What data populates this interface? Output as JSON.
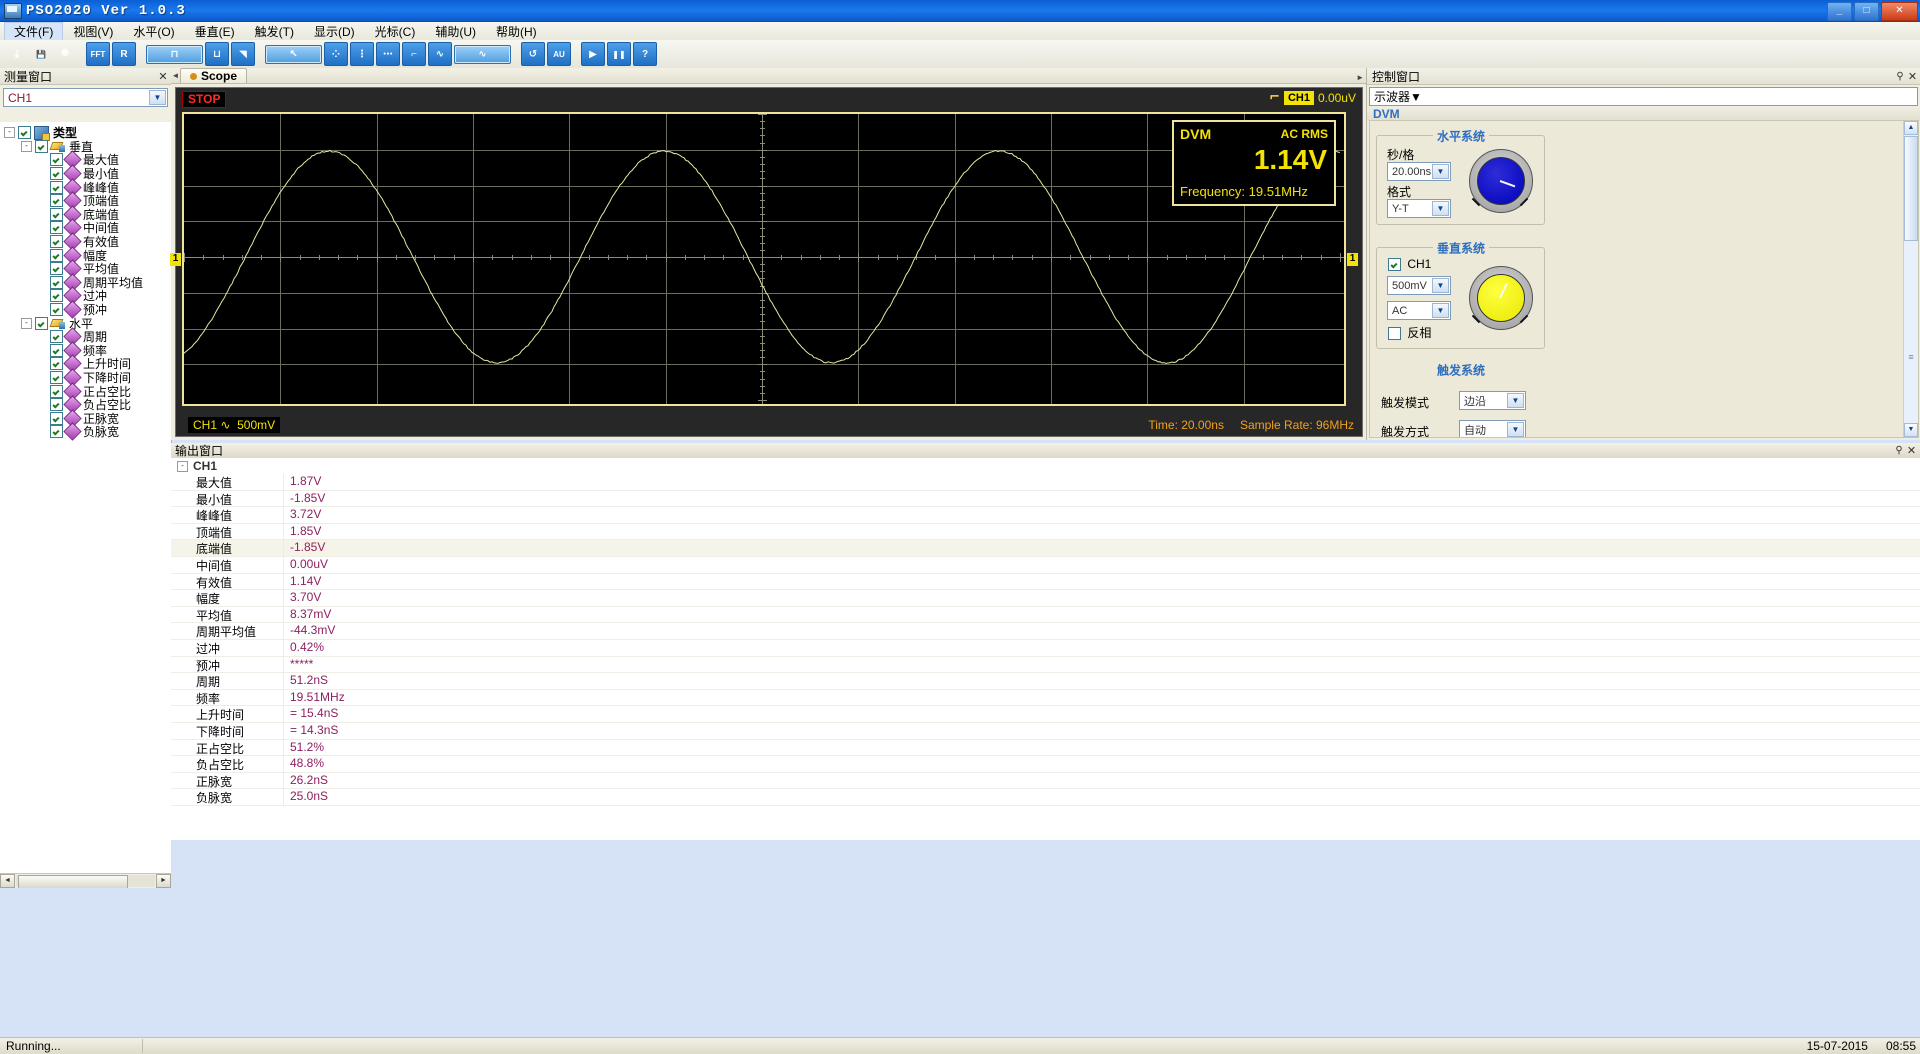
{
  "window": {
    "title": "PSO2020 Ver 1.0.3",
    "minimize": "_",
    "maximize": "□",
    "close": "✕"
  },
  "menu": [
    {
      "label": "文件(F)"
    },
    {
      "label": "视图(V)"
    },
    {
      "label": "水平(O)"
    },
    {
      "label": "垂直(E)"
    },
    {
      "label": "触发(T)"
    },
    {
      "label": "显示(D)"
    },
    {
      "label": "光标(C)"
    },
    {
      "label": "辅助(U)"
    },
    {
      "label": "帮助(H)"
    }
  ],
  "toolbar": [
    {
      "name": "open-icon",
      "glyph": "⤓",
      "style": "plain"
    },
    {
      "name": "save-icon",
      "glyph": "💾",
      "style": "plain"
    },
    {
      "name": "print-icon",
      "glyph": "🖶",
      "style": "plain"
    },
    {
      "name": "fft-icon",
      "glyph": "FFT",
      "style": "blue"
    },
    {
      "name": "record-icon",
      "glyph": "R",
      "style": "blue"
    },
    {
      "name": "square-wave-icon",
      "glyph": "⊓",
      "style": "sel"
    },
    {
      "name": "pulse-icon",
      "glyph": "⊔",
      "style": "blue"
    },
    {
      "name": "ramp-icon",
      "glyph": "◥",
      "style": "blue"
    },
    {
      "name": "cursor-icon",
      "glyph": "↖",
      "style": "sel"
    },
    {
      "name": "grid-icon",
      "glyph": "⁘",
      "style": "blue"
    },
    {
      "name": "vertical-cursor-icon",
      "glyph": "⋮",
      "style": "blue"
    },
    {
      "name": "horizontal-cursor-icon",
      "glyph": "⋯",
      "style": "blue"
    },
    {
      "name": "step-icon",
      "glyph": "⌐",
      "style": "blue"
    },
    {
      "name": "sine-icon",
      "glyph": "∿",
      "style": "blue"
    },
    {
      "name": "sine2-icon",
      "glyph": "∿",
      "style": "sel"
    },
    {
      "name": "undo-icon",
      "glyph": "↺",
      "style": "blue"
    },
    {
      "name": "auto-icon",
      "glyph": "AU",
      "style": "blue"
    },
    {
      "name": "run-icon",
      "glyph": "▶",
      "style": "blue"
    },
    {
      "name": "pause-icon",
      "glyph": "❚❚",
      "style": "blue"
    },
    {
      "name": "help-icon",
      "glyph": "?",
      "style": "blue"
    }
  ],
  "measure_dock": {
    "title": "测量窗口",
    "close": "✕",
    "channel_value": "CH1",
    "tree": [
      {
        "label": "类型",
        "level": 0,
        "icon": "category",
        "expander": "-",
        "checked": true,
        "bold": true
      },
      {
        "label": "垂直",
        "level": 1,
        "icon": "group",
        "expander": "-",
        "checked": true,
        "bold": false
      },
      {
        "label": "最大值",
        "level": 2,
        "icon": "leaf",
        "checked": true
      },
      {
        "label": "最小值",
        "level": 2,
        "icon": "leaf",
        "checked": true
      },
      {
        "label": "峰峰值",
        "level": 2,
        "icon": "leaf",
        "checked": true
      },
      {
        "label": "顶端值",
        "level": 2,
        "icon": "leaf",
        "checked": true
      },
      {
        "label": "底端值",
        "level": 2,
        "icon": "leaf",
        "checked": true
      },
      {
        "label": "中间值",
        "level": 2,
        "icon": "leaf",
        "checked": true
      },
      {
        "label": "有效值",
        "level": 2,
        "icon": "leaf",
        "checked": true
      },
      {
        "label": "幅度",
        "level": 2,
        "icon": "leaf",
        "checked": true
      },
      {
        "label": "平均值",
        "level": 2,
        "icon": "leaf",
        "checked": true
      },
      {
        "label": "周期平均值",
        "level": 2,
        "icon": "leaf",
        "checked": true
      },
      {
        "label": "过冲",
        "level": 2,
        "icon": "leaf",
        "checked": true
      },
      {
        "label": "预冲",
        "level": 2,
        "icon": "leaf",
        "checked": true
      },
      {
        "label": "水平",
        "level": 1,
        "icon": "group",
        "expander": "-",
        "checked": true,
        "bold": false
      },
      {
        "label": "周期",
        "level": 2,
        "icon": "leaf",
        "checked": true
      },
      {
        "label": "频率",
        "level": 2,
        "icon": "leaf",
        "checked": true
      },
      {
        "label": "上升时间",
        "level": 2,
        "icon": "leaf",
        "checked": true
      },
      {
        "label": "下降时间",
        "level": 2,
        "icon": "leaf",
        "checked": true
      },
      {
        "label": "正占空比",
        "level": 2,
        "icon": "leaf",
        "checked": true
      },
      {
        "label": "负占空比",
        "level": 2,
        "icon": "leaf",
        "checked": true
      },
      {
        "label": "正脉宽",
        "level": 2,
        "icon": "leaf",
        "checked": true
      },
      {
        "label": "负脉宽",
        "level": 2,
        "icon": "leaf",
        "checked": true
      }
    ]
  },
  "scope": {
    "tab_label": "Scope",
    "nav_left": "◄",
    "nav_right": "►",
    "run_state": "STOP",
    "trigger_channel": "CH1",
    "trigger_level": "0.00uV",
    "marker_left": "1",
    "marker_right": "1",
    "dvm": {
      "title": "DVM",
      "mode": "AC RMS",
      "value": "1.14V",
      "frequency": "Frequency: 19.51MHz"
    },
    "channel_badge": "CH1",
    "coupling_glyph": "∿",
    "volts_per_div": "500mV",
    "time_label": "Time: 20.00ns",
    "sample_rate_label": "Sample Rate: 96MHz"
  },
  "output_window": {
    "title": "输出窗口",
    "pin": "⚲",
    "close": "✕",
    "group_label": "CH1",
    "group_expander": "-",
    "rows": [
      {
        "label": "最大值",
        "value": "1.87V",
        "highlight": false
      },
      {
        "label": "最小值",
        "value": "-1.85V",
        "highlight": false
      },
      {
        "label": "峰峰值",
        "value": "3.72V",
        "highlight": false
      },
      {
        "label": "顶端值",
        "value": "1.85V",
        "highlight": false
      },
      {
        "label": "底端值",
        "value": "-1.85V",
        "highlight": true
      },
      {
        "label": "中间值",
        "value": "0.00uV",
        "highlight": false
      },
      {
        "label": "有效值",
        "value": "1.14V",
        "highlight": false
      },
      {
        "label": "幅度",
        "value": "3.70V",
        "highlight": false
      },
      {
        "label": "平均值",
        "value": "8.37mV",
        "highlight": false
      },
      {
        "label": "周期平均值",
        "value": "-44.3mV",
        "highlight": false
      },
      {
        "label": "过冲",
        "value": "0.42%",
        "highlight": false
      },
      {
        "label": "预冲",
        "value": "*****",
        "highlight": false
      },
      {
        "label": "周期",
        "value": "51.2nS",
        "highlight": false
      },
      {
        "label": "频率",
        "value": "19.51MHz",
        "highlight": false
      },
      {
        "label": "上升时间",
        "value": "= 15.4nS",
        "highlight": false
      },
      {
        "label": "下降时间",
        "value": "= 14.3nS",
        "highlight": false
      },
      {
        "label": "正占空比",
        "value": "51.2%",
        "highlight": false
      },
      {
        "label": "负占空比",
        "value": "48.8%",
        "highlight": false
      },
      {
        "label": "正脉宽",
        "value": "26.2nS",
        "highlight": false
      },
      {
        "label": "负脉宽",
        "value": "25.0nS",
        "highlight": false
      }
    ]
  },
  "control_dock": {
    "title": "控制窗口",
    "pin": "⚲",
    "close": "✕",
    "device_value": "示波器",
    "tab_label": "DVM",
    "horizontal": {
      "group_title": "水平系统",
      "sec_div_label": "秒/格",
      "sec_div_value": "20.00ns",
      "format_label": "格式",
      "format_value": "Y-T"
    },
    "vertical": {
      "group_title": "垂直系统",
      "channel_label": "CH1",
      "channel_checked": true,
      "volts_div_value": "500mV",
      "coupling_value": "AC",
      "invert_label": "反相",
      "invert_checked": false
    },
    "trigger": {
      "group_title": "触发系统",
      "mode_label": "触发模式",
      "mode_value": "边沿",
      "sweep_label": "触发方式",
      "sweep_value": "自动"
    }
  },
  "statusbar": {
    "message": "Running...",
    "date": "15-07-2015",
    "time": "08:55"
  },
  "colors": {
    "trace": "#e8e8a0",
    "grid": "#6d6d5e",
    "scope_border": "#efe49a",
    "accent_yellow": "#f2e205",
    "value_text": "#8e2060",
    "group_title": "#2f6fc0"
  }
}
